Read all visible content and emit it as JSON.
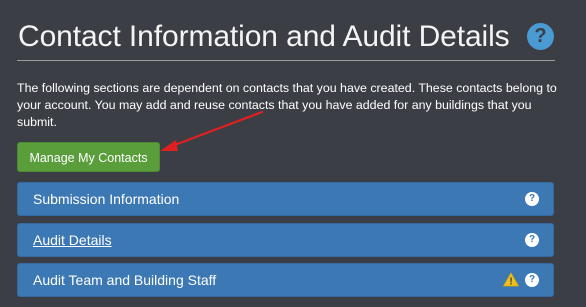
{
  "header": {
    "title": "Contact Information and Audit Details",
    "help_glyph": "?"
  },
  "intro": {
    "text": "The following sections are dependent on contacts that you have created. These contacts belong to your account. You may add and reuse contacts that you have added for any buildings that you submit."
  },
  "actions": {
    "manage_contacts_label": "Manage My Contacts"
  },
  "panels": [
    {
      "label": "Submission Information",
      "help_glyph": "?"
    },
    {
      "label": "Audit Details",
      "help_glyph": "?"
    },
    {
      "label": "Audit Team and Building Staff",
      "help_glyph": "?",
      "warning_glyph": "!"
    }
  ],
  "colors": {
    "background": "#3b3e44",
    "panel": "#3c78b4",
    "button": "#5a9e3c",
    "help": "#4a9bd4",
    "warning": "#f0c020",
    "annotation_arrow": "#e02020"
  },
  "icons": {
    "header_help": "question-circle-icon",
    "panel_help": "question-circle-icon",
    "warning": "warning-triangle-icon",
    "annotation": "red-arrow-icon"
  }
}
